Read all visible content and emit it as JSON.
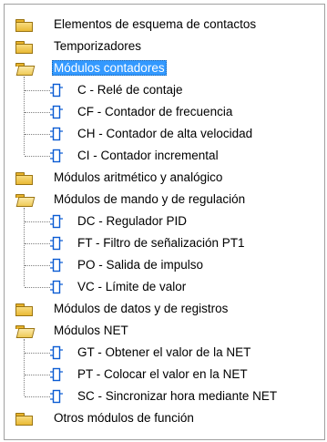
{
  "tree": {
    "items": [
      {
        "label": "Elementos de esquema de contactos",
        "type": "folder",
        "state": "closed"
      },
      {
        "label": "Temporizadores",
        "type": "folder",
        "state": "closed"
      },
      {
        "label": "Módulos contadores",
        "type": "folder",
        "state": "open",
        "selected": true
      },
      {
        "label": "C - Relé de contaje",
        "type": "function-block"
      },
      {
        "label": "CF - Contador de frecuencia",
        "type": "function-block"
      },
      {
        "label": "CH - Contador de alta velocidad",
        "type": "function-block"
      },
      {
        "label": "CI - Contador incremental",
        "type": "function-block"
      },
      {
        "label": "Módulos aritmético y analógico",
        "type": "folder",
        "state": "closed"
      },
      {
        "label": "Módulos de mando y de regulación",
        "type": "folder",
        "state": "open"
      },
      {
        "label": "DC - Regulador PID",
        "type": "function-block"
      },
      {
        "label": "FT - Filtro de señalización PT1",
        "type": "function-block"
      },
      {
        "label": "PO - Salida de impulso",
        "type": "function-block"
      },
      {
        "label": "VC - Límite de valor",
        "type": "function-block"
      },
      {
        "label": "Módulos de datos y de registros",
        "type": "folder",
        "state": "closed"
      },
      {
        "label": "Módulos NET",
        "type": "folder",
        "state": "open"
      },
      {
        "label": "GT - Obtener el valor de la NET",
        "type": "function-block"
      },
      {
        "label": "PT - Colocar el valor en la NET",
        "type": "function-block"
      },
      {
        "label": "SC - Sincronizar hora mediante NET",
        "type": "function-block"
      },
      {
        "label": "Otros módulos de función",
        "type": "folder",
        "state": "closed"
      }
    ]
  },
  "colors": {
    "selection": "#3399ff",
    "folder": "#e9b935",
    "function_block_icon": "#0a5bd3"
  }
}
